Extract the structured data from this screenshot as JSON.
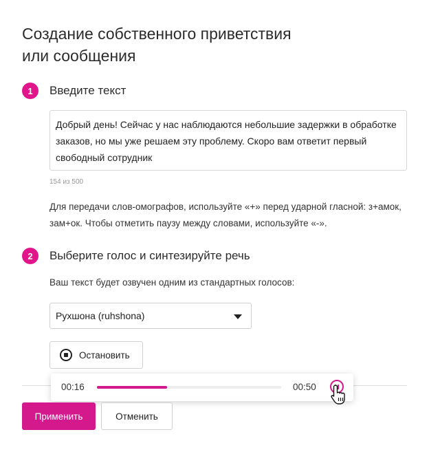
{
  "page": {
    "title_line1": "Создание собственного приветствия",
    "title_line2": "или сообщения"
  },
  "step1": {
    "number": "1",
    "title": "Введите текст",
    "text_value": "Добрый день! Сейчас у нас наблюдаются небольшие задержки в обработке заказов, но мы уже решаем эту проблему. Скоро вам ответит первый свободный сотрудник",
    "counter": "154 из 500",
    "hint": "Для передачи слов-омографов, используйте «+» перед ударной гласной: з+амок, зам+ок. Чтобы отметить паузу между словами, используйте «-»."
  },
  "step2": {
    "number": "2",
    "title": "Выберите голос и синтезируйте речь",
    "subtext": "Ваш текст будет озвучен одним из стандартных голосов:",
    "voice_selected": "Рухшона (ruhshona)",
    "stop_label": "Остановить"
  },
  "player": {
    "current_time": "00:16",
    "total_time": "00:50",
    "progress": 0.38
  },
  "actions": {
    "apply_label": "Применить",
    "cancel_label": "Отменить"
  },
  "colors": {
    "accent": "#d3198c",
    "badge": "#e0168a"
  },
  "icons": {
    "dropdown": "chevron-down-icon",
    "stop": "stop-circle-icon",
    "pause": "pause-icon",
    "cursor": "hand-pointer-icon"
  }
}
